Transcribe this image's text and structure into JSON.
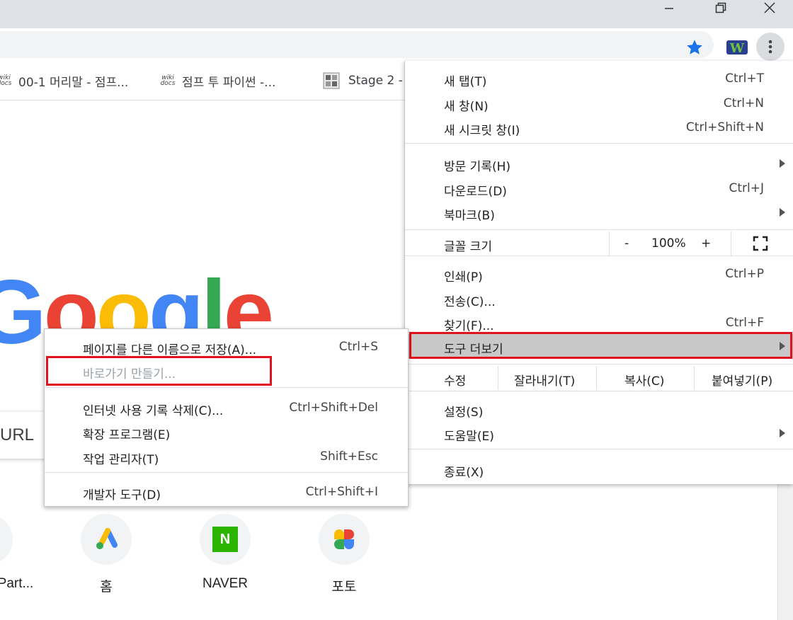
{
  "bookmarks": [
    {
      "icon": "wiki-docs-icon",
      "wiki": "wiki",
      "docs": "docs",
      "label": "00-1 머리말 - 점프..."
    },
    {
      "icon": "wiki-docs-icon",
      "wiki": "wiki",
      "docs": "docs",
      "label": "점프 투 파이썬 -..."
    },
    {
      "icon": "stage-icon",
      "label": "Stage 2 -"
    }
  ],
  "ntp": {
    "logo_letters": [
      {
        "ch": "G",
        "color": "#4285f4"
      },
      {
        "ch": "o",
        "color": "#ea4335"
      },
      {
        "ch": "o",
        "color": "#fbbc05"
      },
      {
        "ch": "g",
        "color": "#4285f4"
      },
      {
        "ch": "l",
        "color": "#34a853"
      },
      {
        "ch": "e",
        "color": "#ea4335"
      }
    ],
    "search_placeholder": "URL",
    "shortcuts": [
      {
        "label": "Part..."
      },
      {
        "label": "홈",
        "icon": "google-ads-icon"
      },
      {
        "label": "NAVER",
        "icon": "naver-icon",
        "icon_text": "N"
      },
      {
        "label": "포토",
        "icon": "google-photos-icon"
      }
    ]
  },
  "main_menu": {
    "new_tab": {
      "label": "새 탭(T)",
      "shortcut": "Ctrl+T"
    },
    "new_window": {
      "label": "새 창(N)",
      "shortcut": "Ctrl+N"
    },
    "incognito": {
      "label": "새 시크릿 창(I)",
      "shortcut": "Ctrl+Shift+N"
    },
    "history": {
      "label": "방문 기록(H)"
    },
    "downloads": {
      "label": "다운로드(D)",
      "shortcut": "Ctrl+J"
    },
    "bookmarks": {
      "label": "북마크(B)"
    },
    "zoom": {
      "label": "글꼴 크기",
      "minus": "-",
      "value": "100%",
      "plus": "+"
    },
    "print": {
      "label": "인쇄(P)",
      "shortcut": "Ctrl+P"
    },
    "cast": {
      "label": "전송(C)..."
    },
    "find": {
      "label": "찾기(F)...",
      "shortcut": "Ctrl+F"
    },
    "more_tools": {
      "label": "도구 더보기"
    },
    "edit": {
      "label": "수정",
      "cut": "잘라내기(T)",
      "copy": "복사(C)",
      "paste": "붙여넣기(P)"
    },
    "settings": {
      "label": "설정(S)"
    },
    "help": {
      "label": "도움말(E)"
    },
    "exit": {
      "label": "종료(X)"
    }
  },
  "sub_menu": {
    "save_as": {
      "label": "페이지를 다른 이름으로 저장(A)...",
      "shortcut": "Ctrl+S"
    },
    "create_shortcut": {
      "label": "바로가기 만들기..."
    },
    "clear_data": {
      "label": "인터넷 사용 기록 삭제(C)...",
      "shortcut": "Ctrl+Shift+Del"
    },
    "extensions": {
      "label": "확장 프로그램(E)"
    },
    "task_manager": {
      "label": "작업 관리자(T)",
      "shortcut": "Shift+Esc"
    },
    "dev_tools": {
      "label": "개발자 도구(D)",
      "shortcut": "Ctrl+Shift+I"
    }
  },
  "colors": {
    "highlight_border": "#e0121d",
    "hover_bg": "#c8c8c8",
    "star": "#1a73e8"
  }
}
